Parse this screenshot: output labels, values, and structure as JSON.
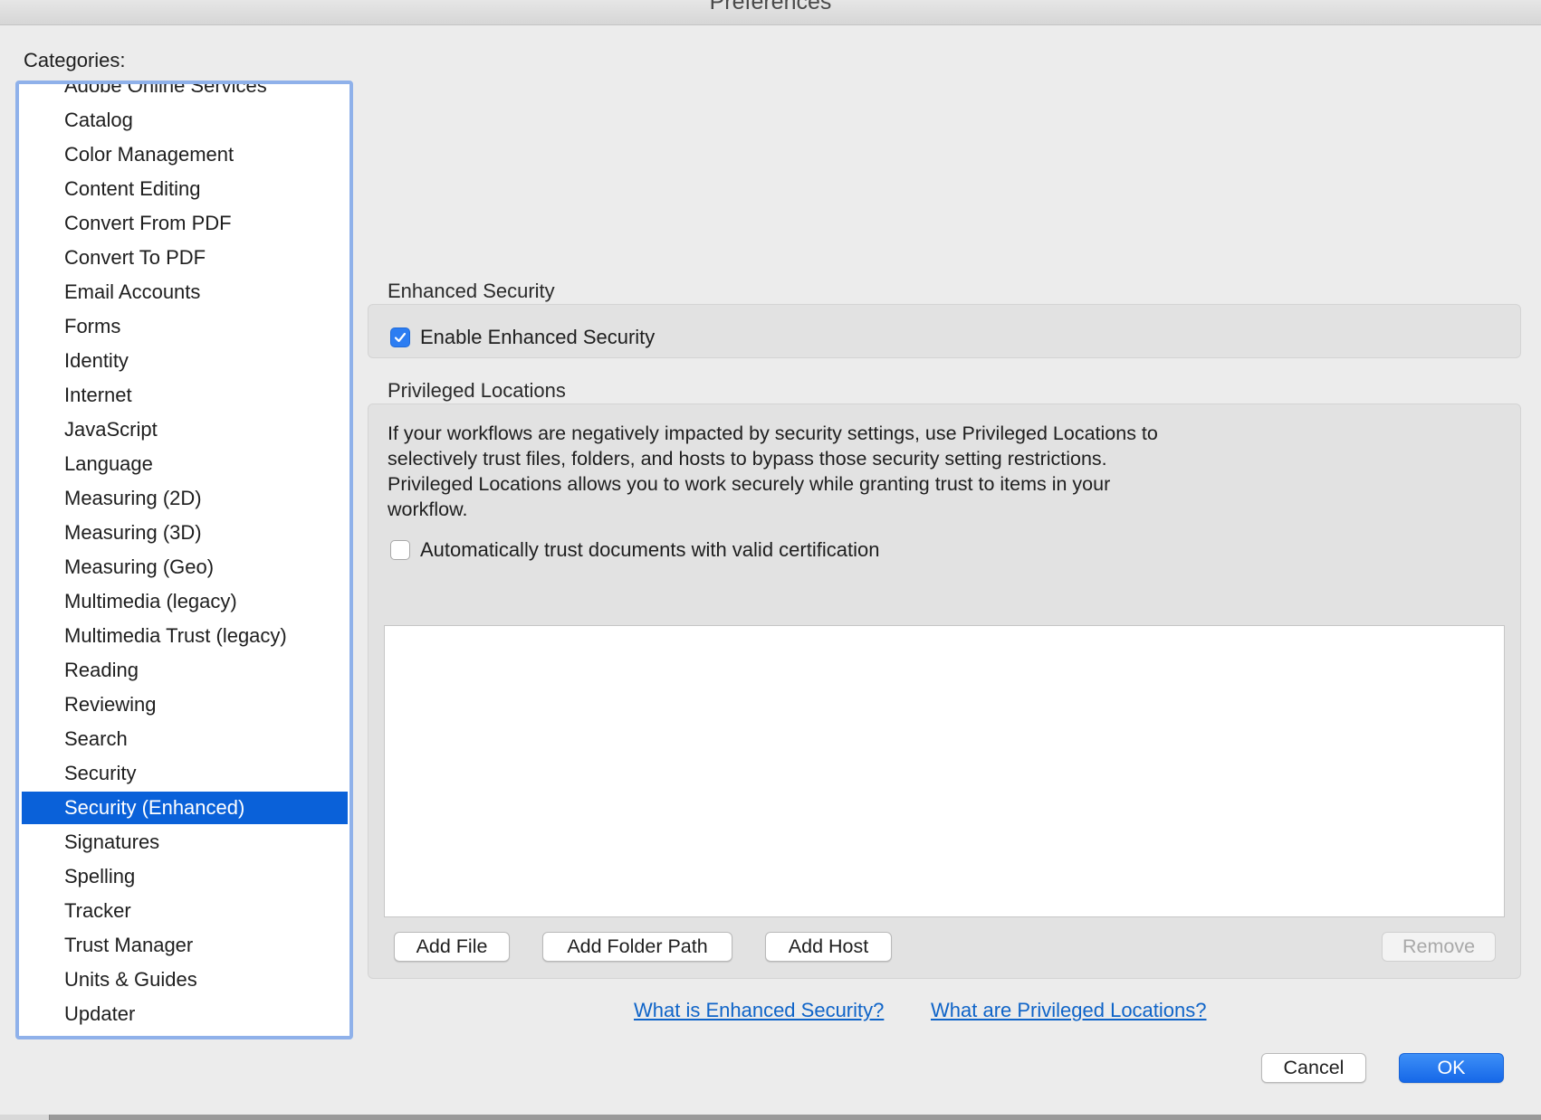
{
  "window": {
    "title": "Preferences"
  },
  "categories": {
    "label": "Categories:",
    "selected_index": 21,
    "items": [
      "Adobe Online Services",
      "Catalog",
      "Color Management",
      "Content Editing",
      "Convert From PDF",
      "Convert To PDF",
      "Email Accounts",
      "Forms",
      "Identity",
      "Internet",
      "JavaScript",
      "Language",
      "Measuring (2D)",
      "Measuring (3D)",
      "Measuring (Geo)",
      "Multimedia (legacy)",
      "Multimedia Trust (legacy)",
      "Reading",
      "Reviewing",
      "Search",
      "Security",
      "Security (Enhanced)",
      "Signatures",
      "Spelling",
      "Tracker",
      "Trust Manager",
      "Units & Guides",
      "Updater"
    ]
  },
  "enhanced_security": {
    "heading": "Enhanced Security",
    "enable_label": "Enable Enhanced Security",
    "enable_checked": true
  },
  "privileged_locations": {
    "heading": "Privileged Locations",
    "description_lines": [
      "If your workflows are negatively impacted by security settings, use Privileged Locations to",
      "selectively trust files, folders, and hosts to bypass those security setting restrictions.",
      "Privileged Locations allows you to work securely while granting trust to items in your",
      "workflow."
    ],
    "auto_trust_label": "Automatically trust documents with valid certification",
    "auto_trust_checked": false,
    "locations": [],
    "buttons": {
      "add_file": "Add File",
      "add_folder_path": "Add Folder Path",
      "add_host": "Add Host",
      "remove": "Remove"
    }
  },
  "links": {
    "what_is_enhanced_security": "What is Enhanced Security?",
    "what_are_privileged_locations": "What are Privileged Locations?"
  },
  "dialog_buttons": {
    "cancel": "Cancel",
    "ok": "OK"
  },
  "colors": {
    "selection": "#0a61d9",
    "link": "#0f64c8",
    "checkbox_on": "#2c7df2",
    "list_focus_ring": "#8fb1ea"
  }
}
